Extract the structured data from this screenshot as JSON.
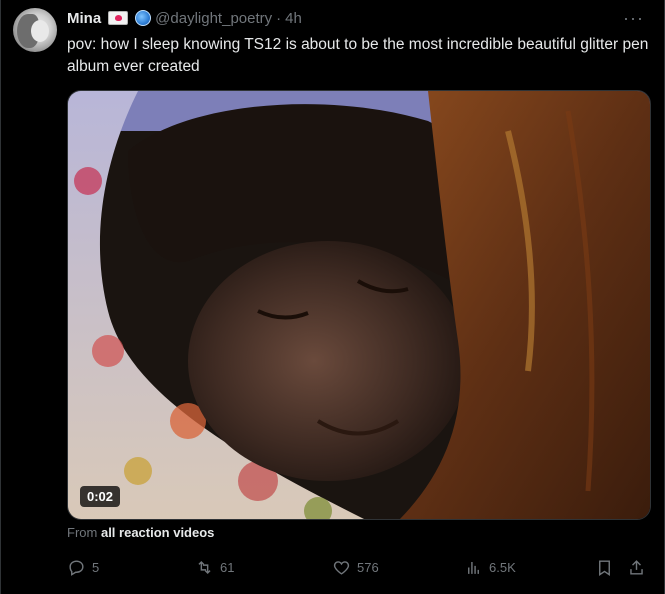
{
  "tweet": {
    "author_name": "Mina",
    "author_handle": "@daylight_poetry",
    "separator": "·",
    "time": "4h",
    "text": "pov: how I sleep knowing TS12 is about to be the most incredible beautiful glitter pen album ever created",
    "video_duration": "0:02",
    "from_prefix": "From",
    "from_source": "all reaction videos"
  },
  "icons": {
    "avatar": "avatar-photo",
    "emoji1": "love-letter-emoji",
    "emoji2": "globe-emoji",
    "more": "more-icon",
    "reply": "reply-icon",
    "retweet": "retweet-icon",
    "like": "heart-icon",
    "views": "views-icon",
    "bookmark": "bookmark-icon",
    "share": "share-icon"
  },
  "actions": {
    "replies": "5",
    "reposts": "61",
    "likes": "576",
    "views": "6.5K"
  },
  "colors": {
    "background": "#000000",
    "text": "#e7e9ea",
    "muted": "#71767b",
    "border": "#2f3336"
  }
}
